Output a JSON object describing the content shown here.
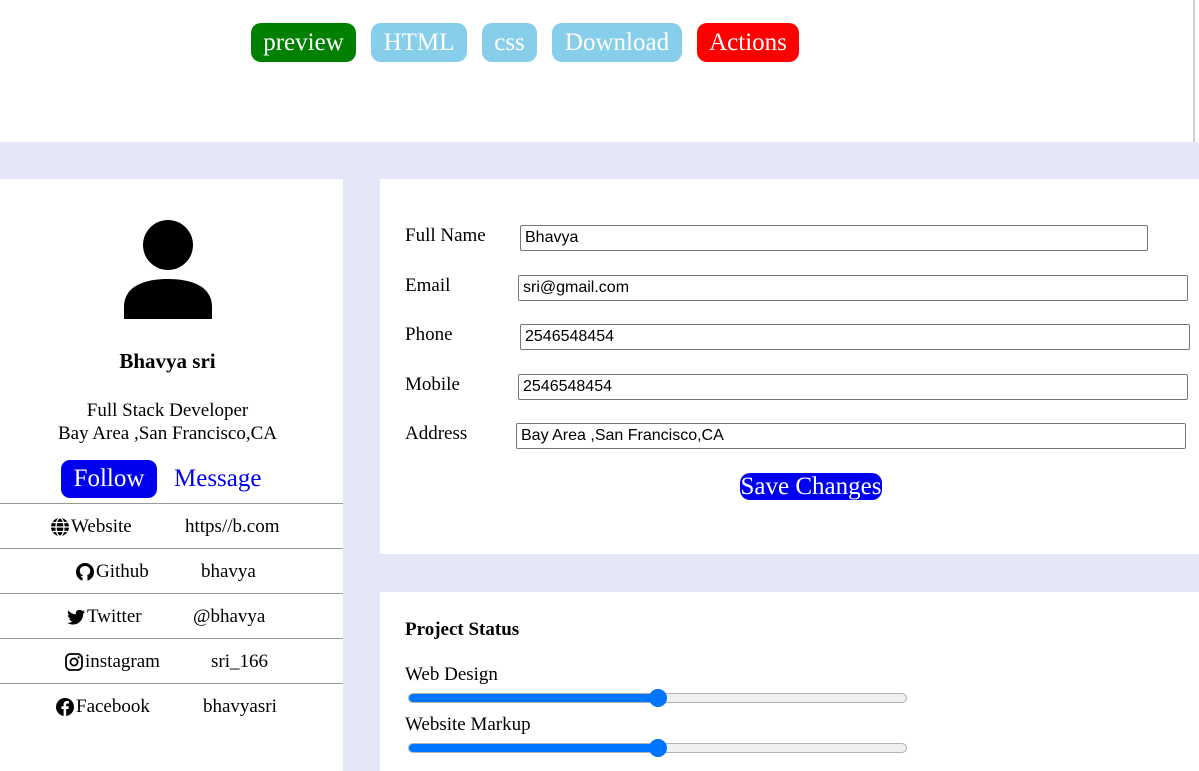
{
  "toolbar": {
    "preview": "preview",
    "html": "HTML",
    "css": "css",
    "download": "Download",
    "actions": "Actions"
  },
  "profile": {
    "name": "Bhavya sri",
    "role": "Full Stack Developer",
    "location": "Bay Area ,San Francisco,CA",
    "follow_label": "Follow",
    "message_label": "Message",
    "links": [
      {
        "icon": "globe-icon",
        "label": "Website",
        "value": "https//b.com"
      },
      {
        "icon": "github-icon",
        "label": "Github",
        "value": "bhavya"
      },
      {
        "icon": "twitter-icon",
        "label": "Twitter",
        "value": "@bhavya"
      },
      {
        "icon": "instagram-icon",
        "label": "instagram",
        "value": "sri_166"
      },
      {
        "icon": "facebook-icon",
        "label": "Facebook",
        "value": "bhavyasri"
      }
    ]
  },
  "form": {
    "fullname_label": "Full Name",
    "fullname_value": "Bhavya",
    "email_label": "Email",
    "email_value": "sri@gmail.com",
    "phone_label": "Phone",
    "phone_value": "2546548454",
    "mobile_label": "Mobile",
    "mobile_value": "2546548454",
    "address_label": "Address",
    "address_value": "Bay Area ,San Francisco,CA",
    "save_label": "Save Changes"
  },
  "project_status": {
    "title": "Project Status",
    "items": [
      {
        "label": "Web Design",
        "value": 50
      },
      {
        "label": "Website Markup",
        "value": 50
      }
    ]
  },
  "colors": {
    "page_background": "#e6e6f9",
    "preview": "#008000",
    "tab_inactive": "#87ceeb",
    "actions": "#ff0000",
    "primary_button": "#0000ee",
    "slider": "#0075ff"
  }
}
